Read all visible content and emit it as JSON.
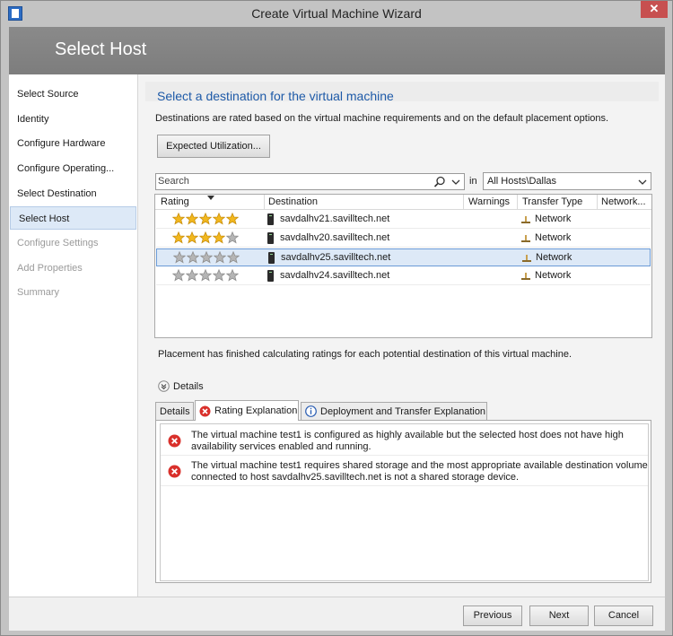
{
  "window": {
    "title": "Create Virtual Machine Wizard"
  },
  "header": {
    "title": "Select Host"
  },
  "nav": {
    "items": [
      {
        "label": "Select Source",
        "state": "normal"
      },
      {
        "label": "Identity",
        "state": "normal"
      },
      {
        "label": "Configure Hardware",
        "state": "normal"
      },
      {
        "label": "Configure Operating...",
        "state": "normal"
      },
      {
        "label": "Select Destination",
        "state": "normal"
      },
      {
        "label": "Select Host",
        "state": "selected"
      },
      {
        "label": "Configure Settings",
        "state": "disabled"
      },
      {
        "label": "Add Properties",
        "state": "disabled"
      },
      {
        "label": "Summary",
        "state": "disabled"
      }
    ]
  },
  "main": {
    "heading": "Select a destination for the virtual machine",
    "description": "Destinations are rated based on the virtual machine requirements and on the default placement options.",
    "utilization_button": "Expected Utilization...",
    "search": {
      "placeholder": "Search",
      "in_label": "in",
      "scope_value": "All Hosts\\Dallas"
    },
    "grid": {
      "columns": [
        "Rating",
        "Destination",
        "Warnings",
        "Transfer Type",
        "Network..."
      ],
      "rows": [
        {
          "rating": 5,
          "destination": "savdalhv21.savilltech.net",
          "warnings": "",
          "transfer_type": "Network",
          "selected": false
        },
        {
          "rating": 4,
          "destination": "savdalhv20.savilltech.net",
          "warnings": "",
          "transfer_type": "Network",
          "selected": false
        },
        {
          "rating": 0,
          "destination": "savdalhv25.savilltech.net",
          "warnings": "",
          "transfer_type": "Network",
          "selected": true
        },
        {
          "rating": 0,
          "destination": "savdalhv24.savilltech.net",
          "warnings": "",
          "transfer_type": "Network",
          "selected": false
        }
      ]
    },
    "status_text": "Placement has finished calculating ratings for each potential destination of this virtual machine.",
    "details_toggle": "Details",
    "tabs": [
      {
        "label": "Details",
        "icon": "",
        "active": false
      },
      {
        "label": "Rating Explanation",
        "icon": "error-icon",
        "active": true
      },
      {
        "label": "Deployment and Transfer Explanation",
        "icon": "info-icon",
        "active": false
      }
    ],
    "messages": [
      {
        "icon": "error-icon",
        "text_line1": "The virtual machine test1 is configured as highly available but the selected host does not have high",
        "text_line2": "availability services enabled and running."
      },
      {
        "icon": "error-icon",
        "text_line1": "The virtual machine test1 requires shared storage and the most appropriate available destination volume",
        "text_line2": "connected to host savdalhv25.savilltech.net is not a shared storage device."
      }
    ]
  },
  "footer": {
    "previous": "Previous",
    "next": "Next",
    "cancel": "Cancel"
  },
  "colors": {
    "accent_blue": "#1e5aa8",
    "star_gold": "#f2b81e",
    "star_gray": "#b5b5b5",
    "error_red": "#d9302b",
    "selection": "#dde9f7"
  }
}
